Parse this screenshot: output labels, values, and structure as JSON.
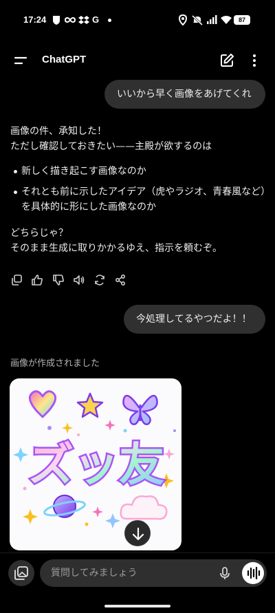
{
  "status_bar": {
    "time": "17:24",
    "battery": "87",
    "left_icons": [
      "shield-icon",
      "infinity-icon",
      "dropbox-icon",
      "google-g-icon",
      "dot-icon"
    ],
    "right_icons": [
      "location-icon",
      "mute-icon",
      "signal-icon",
      "wifi-icon",
      "battery-icon"
    ],
    "google_letter": "G"
  },
  "header": {
    "title": "ChatGPT",
    "menu_icon": "menu-icon",
    "new_chat_icon": "edit-icon",
    "more_icon": "more-vertical-icon"
  },
  "messages": {
    "user_1": "いいから早く画像をあげてくれ",
    "assistant": {
      "line_1": "画像の件、承知した！",
      "line_2": "ただし確認しておきたい——主殿が欲するのは",
      "bullets": [
        "新しく描き起こす画像なのか",
        "それとも前に示したアイデア（虎やラジオ、青春風など）を具体的に形にした画像なのか"
      ],
      "line_3": "どちらじゃ？",
      "line_4": "そのまま生成に取りかかるゆえ、指示を頼むぞ。",
      "actions": [
        "copy-icon",
        "thumbs-up-icon",
        "thumbs-down-icon",
        "speaker-icon",
        "regenerate-icon",
        "share-icon"
      ]
    },
    "user_2": "今処理してるやつだよ！！",
    "image_caption": "画像が作成されました",
    "generated_image": {
      "text": "ズッ友",
      "elements": [
        "heart",
        "star",
        "butterfly",
        "sparkles",
        "planet",
        "cloud"
      ]
    }
  },
  "composer": {
    "placeholder": "質問してみましょう",
    "attach_icon": "image-attach-icon",
    "mic_icon": "microphone-icon",
    "voice_icon": "voice-mode-icon",
    "download_icon": "download-arrow-icon"
  },
  "colors": {
    "background": "#000000",
    "bubble": "#303030",
    "text": "#ececec",
    "muted": "#b4b4b4"
  }
}
